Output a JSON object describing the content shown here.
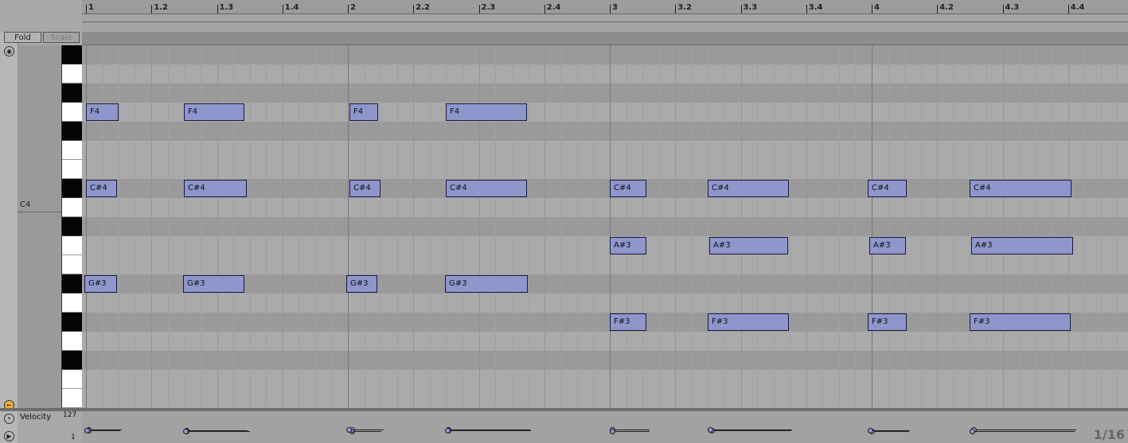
{
  "toolbar": {
    "fold_label": "Fold",
    "scale_label": "Scale"
  },
  "ruler": {
    "bars": [
      "1",
      "1.2",
      "1.3",
      "1.4",
      "2",
      "2.2",
      "2.3",
      "2.4",
      "3",
      "3.2",
      "3.3",
      "3.4",
      "4",
      "4.2",
      "4.3",
      "4.4"
    ]
  },
  "piano": {
    "octave_label": "C4"
  },
  "notes": [
    {
      "pitch": "F4",
      "label": "F4"
    },
    {
      "pitch": "C#4",
      "label": "C#4"
    },
    {
      "pitch": "A#3",
      "label": "A#3"
    },
    {
      "pitch": "G#3",
      "label": "G#3"
    },
    {
      "pitch": "F#3",
      "label": "F#3"
    }
  ],
  "clip_notes": [
    {
      "label": "F4",
      "row": 3,
      "start": 0.0,
      "len": 0.125
    },
    {
      "label": "F4",
      "row": 3,
      "start": 0.375,
      "len": 0.23
    },
    {
      "label": "F4",
      "row": 3,
      "start": 1.005,
      "len": 0.11
    },
    {
      "label": "F4",
      "row": 3,
      "start": 1.375,
      "len": 0.31
    },
    {
      "label": "C#4",
      "row": 7,
      "start": 0.0,
      "len": 0.12
    },
    {
      "label": "C#4",
      "row": 7,
      "start": 0.375,
      "len": 0.24
    },
    {
      "label": "C#4",
      "row": 7,
      "start": 1.005,
      "len": 0.12
    },
    {
      "label": "C#4",
      "row": 7,
      "start": 1.375,
      "len": 0.31
    },
    {
      "label": "C#4",
      "row": 7,
      "start": 2.0,
      "len": 0.14
    },
    {
      "label": "C#4",
      "row": 7,
      "start": 2.375,
      "len": 0.31
    },
    {
      "label": "C#4",
      "row": 7,
      "start": 2.985,
      "len": 0.15
    },
    {
      "label": "C#4",
      "row": 7,
      "start": 3.375,
      "len": 0.39
    },
    {
      "label": "A#3",
      "row": 10,
      "start": 2.0,
      "len": 0.14
    },
    {
      "label": "A#3",
      "row": 10,
      "start": 2.38,
      "len": 0.3
    },
    {
      "label": "A#3",
      "row": 10,
      "start": 2.99,
      "len": 0.14
    },
    {
      "label": "A#3",
      "row": 10,
      "start": 3.38,
      "len": 0.39
    },
    {
      "label": "G#3",
      "row": 12,
      "start": -0.005,
      "len": 0.125
    },
    {
      "label": "G#3",
      "row": 12,
      "start": 0.37,
      "len": 0.235
    },
    {
      "label": "G#3",
      "row": 12,
      "start": 0.995,
      "len": 0.12
    },
    {
      "label": "G#3",
      "row": 12,
      "start": 1.37,
      "len": 0.315
    },
    {
      "label": "F#3",
      "row": 14,
      "start": 2.0,
      "len": 0.14
    },
    {
      "label": "F#3",
      "row": 14,
      "start": 2.375,
      "len": 0.31
    },
    {
      "label": "F#3",
      "row": 14,
      "start": 2.985,
      "len": 0.15
    },
    {
      "label": "F#3",
      "row": 14,
      "start": 3.375,
      "len": 0.385
    }
  ],
  "velocity": {
    "label": "Velocity",
    "max": "127",
    "min": "1",
    "grid": "1/16"
  },
  "colors": {
    "note_fill": "#8e96cc",
    "lane_dark": "#9a9a9a",
    "lane_light": "#aaaaaa"
  }
}
